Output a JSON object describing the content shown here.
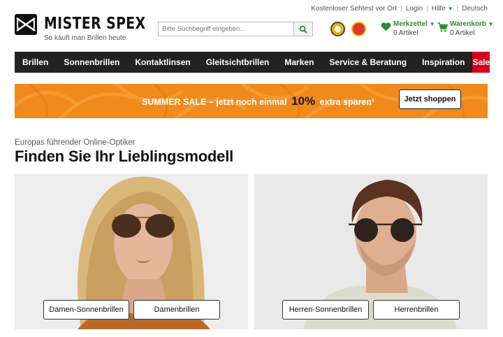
{
  "utility_links": {
    "items": [
      "Kostenloser Sehtest vor Ort",
      "Login",
      "Hilfe",
      "Deutsch"
    ]
  },
  "logo": {
    "name": "MISTER SPEX",
    "tagline": "So kauft man Brillen heute"
  },
  "search": {
    "placeholder": "Bitte Suchbegriff eingeben..."
  },
  "account": {
    "wishlist_label": "Merkzettel",
    "wishlist_count": "0 Artikel",
    "cart_label": "Warenkorb",
    "cart_count": "0 Artikel"
  },
  "nav": {
    "items": [
      "Brillen",
      "Sonnenbrillen",
      "Kontaktlinsen",
      "Gleitsichtbrillen",
      "Marken",
      "Service & Beratung",
      "Inspiration"
    ],
    "sale": "Sale"
  },
  "banner": {
    "text_before": "SUMMER SALE – jetzt noch einmal",
    "highlight": "10%",
    "text_after": "extra sparen¹",
    "button": "Jetzt shoppen"
  },
  "intro": {
    "subtitle": "Europas führender Online-Optiker",
    "title": "Finden Sie Ihr Lieblingsmodell"
  },
  "tiles": {
    "women": [
      "Damen-Sonnenbrillen",
      "Damenbrillen"
    ],
    "men": [
      "Herren-Sonnenbrillen",
      "Herrenbrillen"
    ]
  },
  "colors": {
    "accent_green": "#2e8b2e",
    "nav_bg": "#222222",
    "sale_red": "#d6001c",
    "banner_orange": "#f08a1c"
  }
}
